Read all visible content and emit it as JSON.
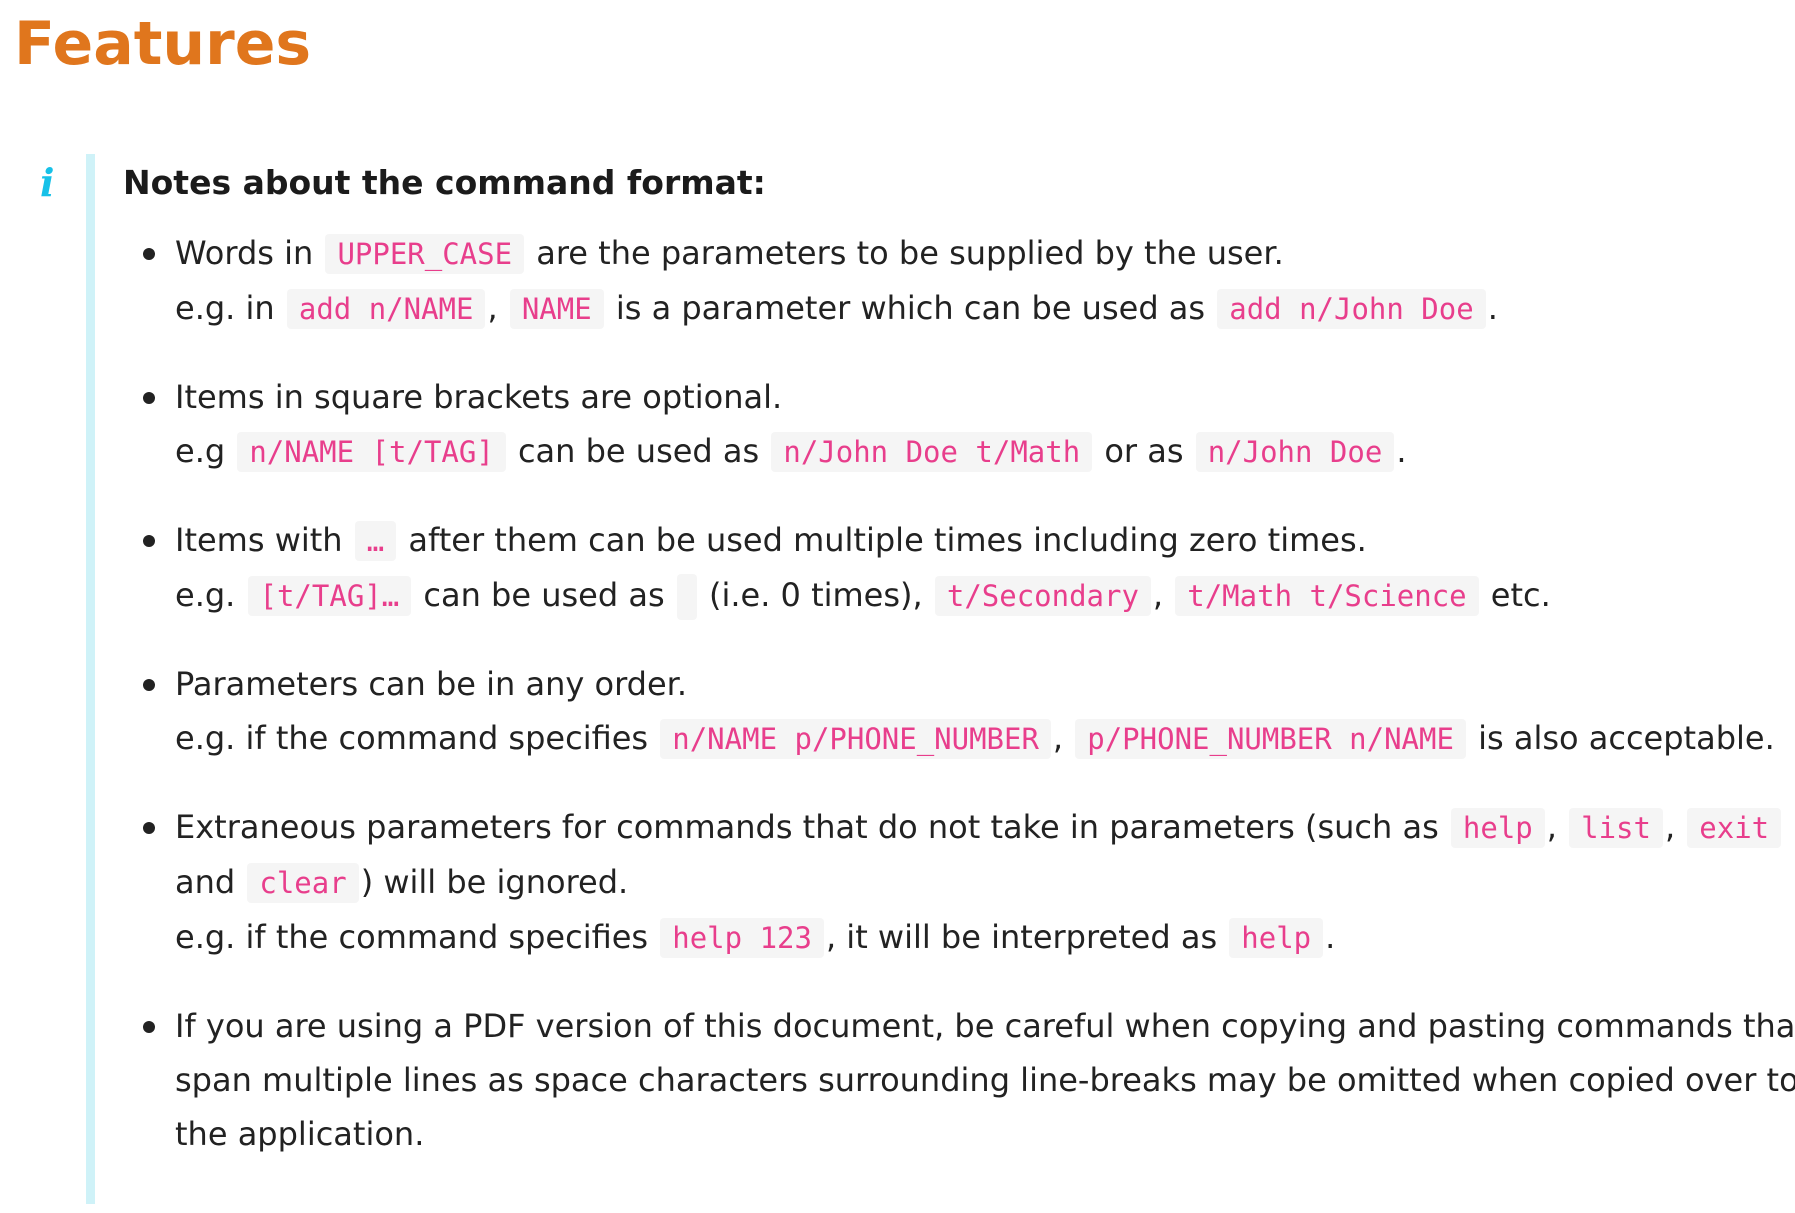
{
  "page": {
    "title": "Features"
  },
  "callout": {
    "icon": "info-icon",
    "heading": "Notes about the command format:"
  },
  "notes": [
    {
      "l1_a": "Words in",
      "l1_c1": "UPPER_CASE",
      "l1_b": "are the parameters to be supplied by the user.",
      "l2_a": "e.g. in",
      "l2_c1": "add n/NAME",
      "l2_b": ",",
      "l2_c2": "NAME",
      "l2_c": "is a parameter which can be used as",
      "l2_c3": "add n/John Doe",
      "l2_d": "."
    },
    {
      "l1_a": "Items in square brackets are optional.",
      "l2_a": "e.g",
      "l2_c1": "n/NAME [t/TAG]",
      "l2_b": "can be used as",
      "l2_c2": "n/John Doe t/Math",
      "l2_c": "or as",
      "l2_c3": "n/John Doe",
      "l2_d": "."
    },
    {
      "l1_a": "Items with",
      "l1_c1": "…",
      "l1_b": "after them can be used multiple times including zero times.",
      "l2_a": "e.g.",
      "l2_c1": "[t/TAG]…",
      "l2_b": "can be used as",
      "l2_c2": "",
      "l2_c": "(i.e. 0 times),",
      "l2_c3": "t/Secondary",
      "l2_d": ",",
      "l2_c4": "t/Math t/Science",
      "l2_e": "etc."
    },
    {
      "l1_a": "Parameters can be in any order.",
      "l2_a": "e.g. if the command specifies",
      "l2_c1": "n/NAME p/PHONE_NUMBER",
      "l2_b": ",",
      "l2_c2": "p/PHONE_NUMBER n/NAME",
      "l2_c": "is also acceptable."
    },
    {
      "l1_a": "Extraneous parameters for commands that do not take in parameters (such as",
      "l1_c1": "help",
      "l1_b": ",",
      "l1_c2": "list",
      "l1_c": ",",
      "l1_c3": "exit",
      "l2_a": "and",
      "l2_c1": "clear",
      "l2_b": ") will be ignored.",
      "l3_a": "e.g. if the command specifies",
      "l3_c1": "help 123",
      "l3_b": ", it will be interpreted as",
      "l3_c2": "help",
      "l3_c": "."
    },
    {
      "l1_a": "If you are using a PDF version of this document, be careful when copying and pasting commands that",
      "l2_a": "span multiple lines as space characters surrounding line-breaks may be omitted when copied over to",
      "l3_a": "the application."
    }
  ]
}
